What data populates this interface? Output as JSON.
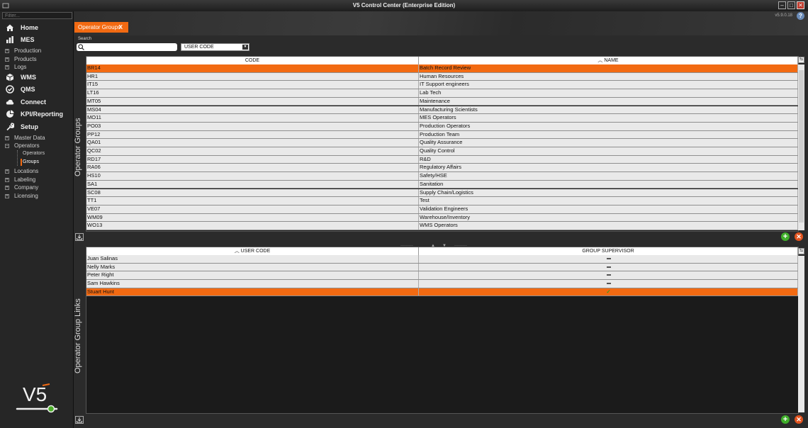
{
  "window": {
    "title": "V5 Control Center (Enterprise Edition)",
    "version": "v5.9.0.18"
  },
  "sidebar": {
    "filter_placeholder": "Filter...",
    "main_items": [
      {
        "label": "Home",
        "icon": "home-icon"
      },
      {
        "label": "MES",
        "icon": "bar-chart-icon"
      },
      {
        "label": "WMS",
        "icon": "box-icon"
      },
      {
        "label": "QMS",
        "icon": "check-circle-icon"
      },
      {
        "label": "Connect",
        "icon": "cloud-icon"
      },
      {
        "label": "KPI/Reporting",
        "icon": "pie-chart-icon"
      },
      {
        "label": "Setup",
        "icon": "wrench-icon"
      }
    ],
    "mes_children": [
      "Production",
      "Products",
      "Logs"
    ],
    "setup_children": [
      "Master Data",
      "Operators",
      "Locations",
      "Labeling",
      "Company",
      "Licensing"
    ],
    "operators_children": [
      "Operators",
      "Groups"
    ]
  },
  "tab": {
    "label": "Operator Groups",
    "close": "X"
  },
  "search": {
    "label": "Search",
    "value": "",
    "field": "USER CODE"
  },
  "groups": {
    "section_title": "Operator Groups",
    "columns": [
      "CODE",
      "NAME"
    ],
    "sorted_column": "NAME",
    "selected_index": 0,
    "rows": [
      [
        "BR14",
        "Batch Record Review"
      ],
      [
        "HR1",
        "Human Resources"
      ],
      [
        "IT15",
        "IT Support engineers"
      ],
      [
        "LT16",
        "Lab Tech"
      ],
      [
        "MT05",
        "Maintenance"
      ],
      [
        "MS04",
        "Manufacturing Scientists"
      ],
      [
        "MO11",
        "MES Operators"
      ],
      [
        "PO03",
        "Production Operators"
      ],
      [
        "PP12",
        "Production Team"
      ],
      [
        "QA01",
        "Quality Assurance"
      ],
      [
        "QC02",
        "Quality Control"
      ],
      [
        "RD17",
        "R&D"
      ],
      [
        "RA06",
        "Regulatory Affairs"
      ],
      [
        "HS10",
        "Safety/HSE"
      ],
      [
        "SA1",
        "Sanitation"
      ],
      [
        "SC08",
        "Supply Chain/Logistics"
      ],
      [
        "TT1",
        "Test"
      ],
      [
        "VE07",
        "Validation Engineers"
      ],
      [
        "WM09",
        "Warehouse/Inventory"
      ],
      [
        "WO13",
        "WMS Operators"
      ]
    ]
  },
  "links": {
    "section_title": "Operator Group Links",
    "columns": [
      "USER CODE",
      "GROUP SUPERVISOR"
    ],
    "sorted_column": "USER CODE",
    "selected_index": 4,
    "rows": [
      {
        "user": "Juan Salinas",
        "supervisor": false
      },
      {
        "user": "Nelly Marks",
        "supervisor": false
      },
      {
        "user": "Peter Right",
        "supervisor": false
      },
      {
        "user": "Sam Hawkins",
        "supervisor": false
      },
      {
        "user": "Stuart Hunt",
        "supervisor": true
      }
    ]
  },
  "colors": {
    "accent": "#f26a12",
    "row": "#e9e9e9",
    "add": "#3fae2a",
    "delete": "#e2531e"
  },
  "logo_text": "V5"
}
